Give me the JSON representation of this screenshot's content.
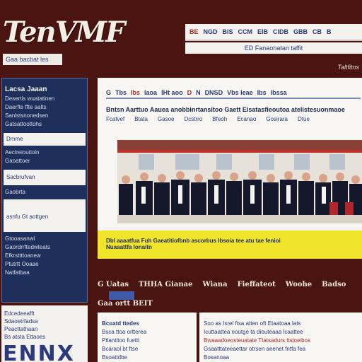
{
  "header": {
    "logo": "TenVMF",
    "tagline": "Gaa bacbat les",
    "top_nav": [
      "BE",
      "NGD",
      "BIS",
      "CCM",
      "EIB",
      "CIDB",
      "GBB",
      "CB",
      "B"
    ],
    "sub_nav": "ED Fanaonatan taffit",
    "top_right_link": "Taltfitns"
  },
  "sidebar": {
    "title": "Lacsa Jaaan",
    "lines": [
      "Desertis wuatatinen",
      "Daerfte ffte aalts",
      "Sanlstsnonedsen",
      "Gatsattoottohs"
    ],
    "field1": "Dmme",
    "lines2": [
      "Aectreioutioln",
      "Gaoattoer"
    ],
    "field2": "Sacbrufvan",
    "line3": "Gaobrta",
    "box": "asnfu Gt aottgen",
    "lines4": [
      "Gtooasanwi",
      "Gaordrrftedwteats",
      "Efkrsttttoanew",
      "Ptutrtt Ooaae",
      "Natfatbaa"
    ]
  },
  "sidebar_card": {
    "lines": [
      "Edcedeeafft",
      "Sdaoetrfadsa",
      "Peacttathaan",
      "Bs atsta Ettaoes"
    ],
    "big_text": "ENNX"
  },
  "main": {
    "nav": [
      {
        "label": "G",
        "red": false
      },
      {
        "label": "Tbs",
        "red": false
      },
      {
        "label": "Ibs",
        "red": true
      },
      {
        "label": "Iaoa",
        "red": false
      },
      {
        "label": "IHt aoo",
        "red": false
      },
      {
        "label": "D",
        "red": true
      },
      {
        "label": "N",
        "red": false
      },
      {
        "label": "DNSD",
        "red": false
      },
      {
        "label": "Vbs Ieae",
        "red": false
      },
      {
        "label": "Ibs",
        "red": false
      },
      {
        "label": "Ibssa",
        "red": false
      }
    ],
    "headline": "Bntsn Aarttuo Aauea anobbinrtansitoo Gaett Eisatasfieoutoa atelistesuonmaoe",
    "sub_links": [
      "Fcatvef",
      "Btata",
      "Gasoe",
      "Dcstrro",
      "Bfeoh",
      "Ecanao",
      "Gosirara",
      "Dtue"
    ],
    "caption_lines": [
      "Dbl aaaatfua Fuh Gaeatitiofbnb ascorbus Ibsoia tee atu tae fenioi",
      "Nuaaattfa Ionaitn"
    ]
  },
  "strip": {
    "items": [
      "G Uatas",
      "THHA Gianae",
      "Wiana",
      "Fieffateot",
      "Woohe",
      "Badso"
    ],
    "more_link": "Gaa ortt BEIT"
  },
  "bottom_left": {
    "lines": [
      "Bcoatd ttedes",
      "Bsca ttoa ortterea",
      "Ptlantitoo fuettt",
      "Bcaraol bt ftse",
      "Bsoattdbe"
    ]
  },
  "bottom_right": {
    "lines": [
      {
        "text": "Soo as Isrel ftsa atten oft Etaatoaa lats",
        "red": false,
        "bold": false
      },
      {
        "text": "Icuttaattea eoutge ta diouteaaa lcaattee ",
        "red": false,
        "bold": false
      },
      {
        "text": "Bwaaadoeosteuatate Ttatsadurs ttsioeibos",
        "red": true,
        "bold": false
      },
      {
        "text": "Gsaatttateeaettar otrsen aeenet fntfa fea",
        "red": false,
        "bold": false
      },
      {
        "text": "Bosanoaa",
        "red": false,
        "bold": false
      }
    ]
  },
  "colors": {
    "background": "#4a1410",
    "sidebar": "#1f2f5c",
    "panel": "#f7f6f3",
    "caption_bar": "#f0e52b",
    "accent_red": "#b02a2a",
    "accent_blue": "#3f5aa8"
  }
}
